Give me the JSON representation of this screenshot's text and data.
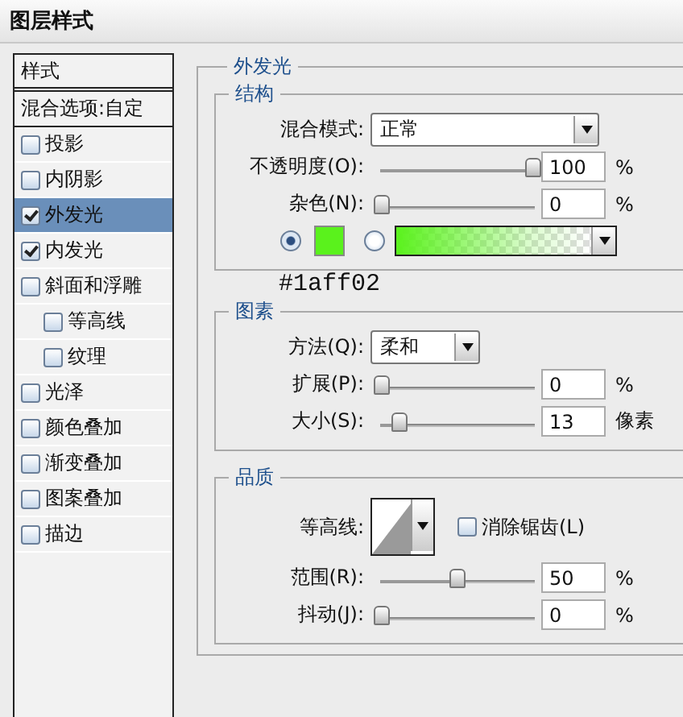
{
  "window": {
    "title": "图层样式"
  },
  "styles_list": {
    "header": "样式",
    "blend_options": "混合选项:自定",
    "items": [
      {
        "label": "投影",
        "checked": false,
        "selected": false
      },
      {
        "label": "内阴影",
        "checked": false,
        "selected": false
      },
      {
        "label": "外发光",
        "checked": true,
        "selected": true
      },
      {
        "label": "内发光",
        "checked": true,
        "selected": false
      },
      {
        "label": "斜面和浮雕",
        "checked": false,
        "selected": false,
        "children": [
          {
            "label": "等高线",
            "checked": false,
            "selected": false
          },
          {
            "label": "纹理",
            "checked": false,
            "selected": false
          }
        ]
      },
      {
        "label": "光泽",
        "checked": false,
        "selected": false
      },
      {
        "label": "颜色叠加",
        "checked": false,
        "selected": false
      },
      {
        "label": "渐变叠加",
        "checked": false,
        "selected": false
      },
      {
        "label": "图案叠加",
        "checked": false,
        "selected": false
      },
      {
        "label": "描边",
        "checked": false,
        "selected": false
      }
    ]
  },
  "outer_glow": {
    "title": "外发光",
    "structure": {
      "title": "结构",
      "blend_mode": {
        "label": "混合模式:",
        "value": "正常"
      },
      "opacity": {
        "label": "不透明度(O):",
        "level": 1,
        "value": "100",
        "unit": "%"
      },
      "noise": {
        "label": "杂色(N):",
        "level": 0,
        "value": "0",
        "unit": "%"
      },
      "fill_options": [
        {
          "kind": "solid",
          "selected": true,
          "color": "#5af21c"
        },
        {
          "kind": "gradient",
          "selected": false,
          "color": "#5af21c"
        }
      ]
    },
    "annotation": "#1aff02",
    "elements": {
      "title": "图素",
      "technique": {
        "label": "方法(Q):",
        "value": "柔和"
      },
      "spread": {
        "label": "扩展(P):",
        "level": 0,
        "value": "0",
        "unit": "%"
      },
      "size": {
        "label": "大小(S):",
        "level": 0.12,
        "value": "13",
        "unit": "像素"
      }
    },
    "quality": {
      "title": "品质",
      "contour": {
        "label": "等高线:"
      },
      "anti_alias": {
        "label": "消除锯齿(L)",
        "checked": false
      },
      "range": {
        "label": "范围(R):",
        "level": 0.5,
        "value": "50",
        "unit": "%"
      },
      "jitter": {
        "label": "抖动(J):",
        "level": 0,
        "value": "0",
        "unit": "%"
      }
    }
  }
}
